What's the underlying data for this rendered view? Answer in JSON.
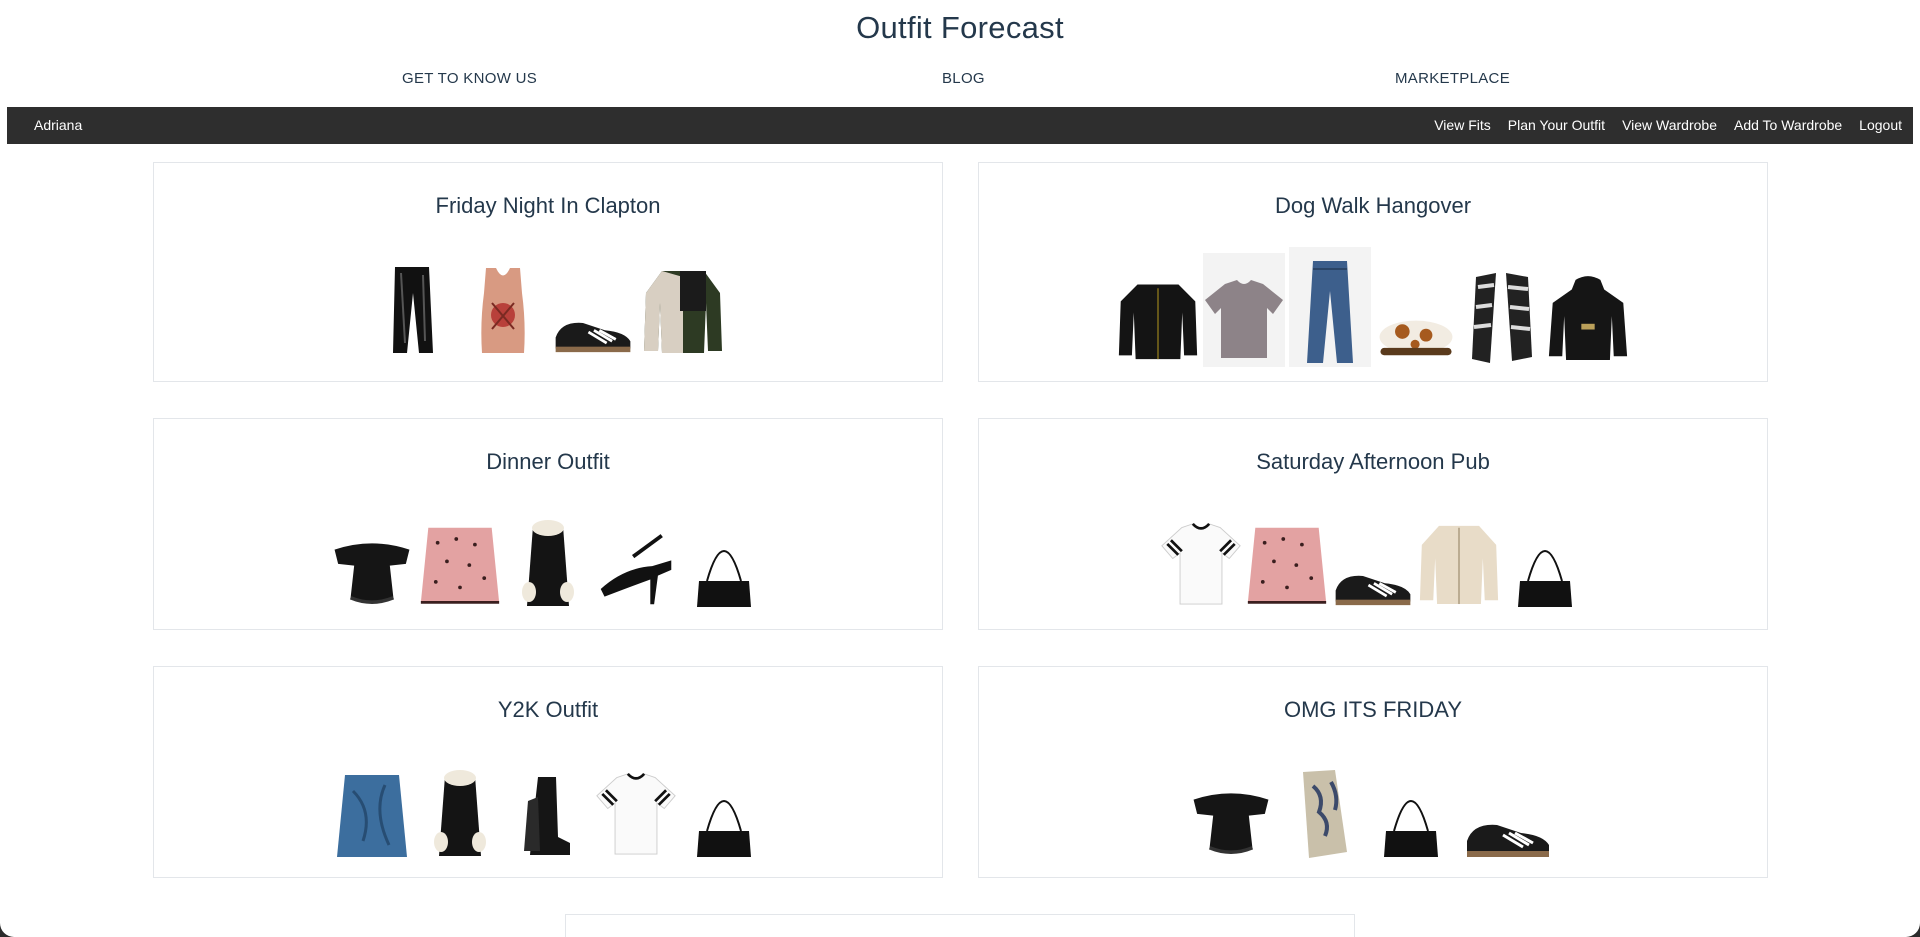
{
  "header": {
    "brand": "Outfit Forecast",
    "nav": [
      "GET TO KNOW US",
      "BLOG",
      "MARKETPLACE"
    ]
  },
  "userbar": {
    "username": "Adriana",
    "links": [
      "View Fits",
      "Plan Your Outfit",
      "View Wardrobe",
      "Add To Wardrobe",
      "Logout"
    ]
  },
  "outfits": [
    {
      "title": "Friday Night In Clapton",
      "items": [
        "black-vinyl-trousers-icon",
        "printed-tank-top-icon",
        "black-sneakers-icon",
        "bomber-jacket-icon"
      ]
    },
    {
      "title": "Dog Walk Hangover",
      "items": [
        "black-cardigan-icon",
        "grey-tshirt-icon",
        "blue-jeans-icon",
        "cow-print-clogs-icon",
        "striped-scarf-icon",
        "black-hoodie-icon"
      ]
    },
    {
      "title": "Dinner Outfit",
      "items": [
        "black-ruffle-top-icon",
        "pink-polka-skirt-icon",
        "black-fur-coat-icon",
        "black-heels-icon",
        "black-shoulder-bag-icon"
      ]
    },
    {
      "title": "Saturday Afternoon Pub",
      "items": [
        "white-stripe-tshirt-icon",
        "pink-polka-skirt-icon",
        "black-sneakers-icon",
        "cream-jacket-icon",
        "black-shoulder-bag-icon"
      ]
    },
    {
      "title": "Y2K Outfit",
      "items": [
        "denim-skirt-icon",
        "black-fur-coat-icon",
        "black-boots-icon",
        "white-stripe-tshirt-icon",
        "black-shoulder-bag-icon"
      ]
    },
    {
      "title": "OMG ITS FRIDAY",
      "items": [
        "black-ruffle-top-icon",
        "paisley-skirt-icon",
        "black-shoulder-bag-icon",
        "black-sneakers-icon"
      ]
    }
  ]
}
